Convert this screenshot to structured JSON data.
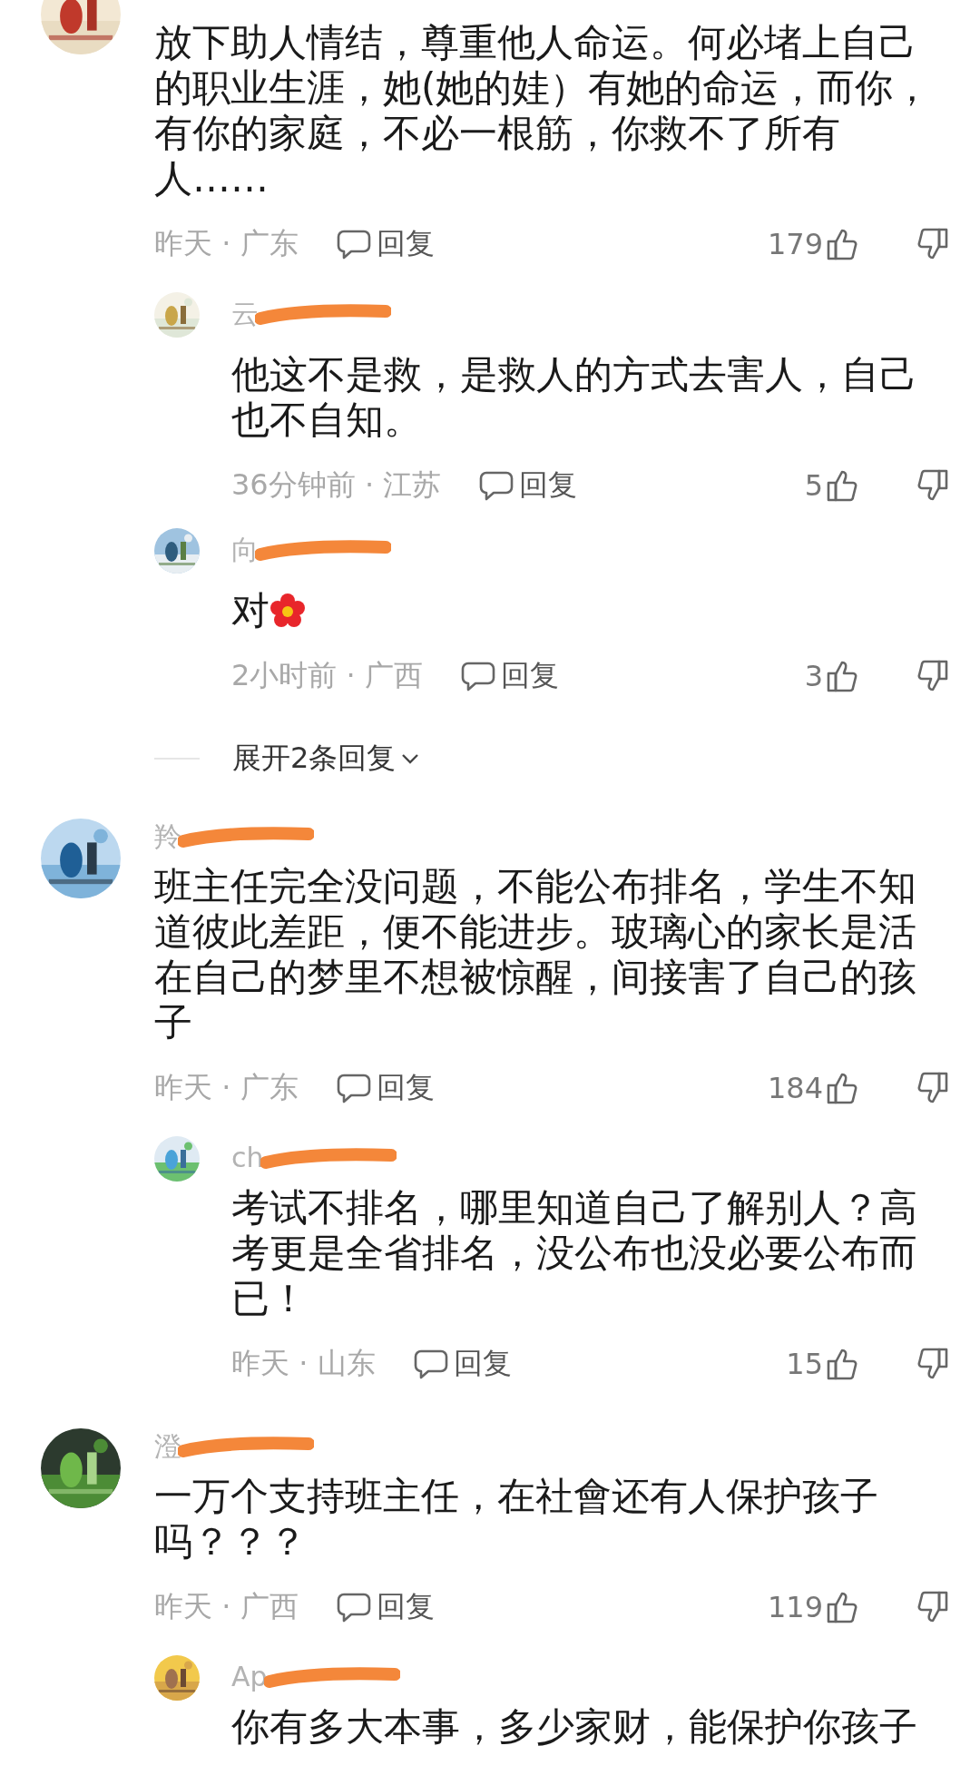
{
  "comments": [
    {
      "text": "放下助人情结，尊重他人命运。何必堵上自己的职业生涯，她(她的娃）有她的命运，而你，有你的家庭，不必一根筋，你救不了所有人……",
      "meta": "昨天 · 广东",
      "reply_label": "回复",
      "likes": "179",
      "replies": [
        {
          "name": "云",
          "text": "他这不是救，是救人的方式去害人，自己也不自知。",
          "meta": "36分钟前 · 江苏",
          "reply_label": "回复",
          "likes": "5"
        },
        {
          "name": "向",
          "text": "对",
          "emoji": true,
          "meta": "2小时前 · 广西",
          "reply_label": "回复",
          "likes": "3"
        }
      ],
      "expand_label": "展开2条回复"
    },
    {
      "name": "羚",
      "text": "班主任完全没问题，不能公布排名，学生不知道彼此差距，便不能进步。玻璃心的家长是活在自己的梦里不想被惊醒，间接害了自己的孩子",
      "meta": "昨天 · 广东",
      "reply_label": "回复",
      "likes": "184",
      "replies": [
        {
          "name": "ch",
          "text": "考试不排名，哪里知道自己了解别人？高考更是全省排名，没公布也没必要公布而已！",
          "meta": "昨天 · 山东",
          "reply_label": "回复",
          "likes": "15"
        }
      ]
    },
    {
      "name": "澄",
      "text": "一万个支持班主任，在社會还有人保护孩子吗？？？",
      "meta": "昨天 · 广西",
      "reply_label": "回复",
      "likes": "119",
      "replies": [
        {
          "name": "Ap",
          "text": "你有多大本事，多少家财，能保护你孩子"
        }
      ]
    }
  ]
}
